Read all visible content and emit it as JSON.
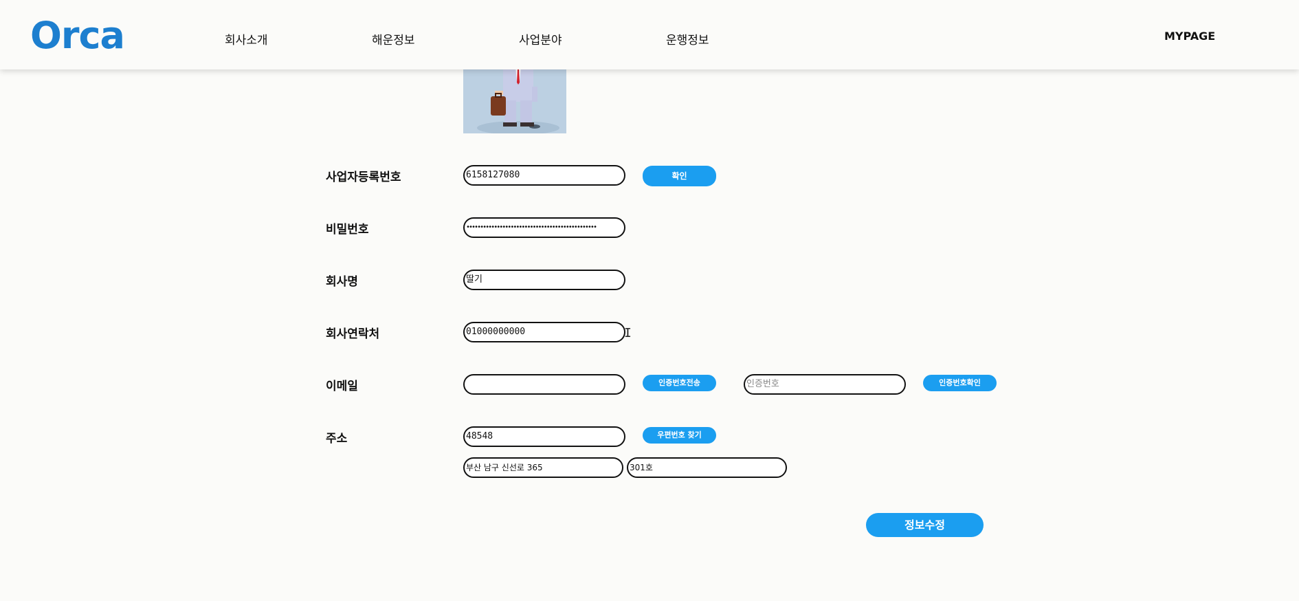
{
  "header": {
    "logo": "Orca",
    "nav": [
      "회사소개",
      "해운정보",
      "사업분야",
      "운행정보"
    ],
    "mypage": "MYPAGE"
  },
  "form": {
    "business_number": {
      "label": "사업자등록번호",
      "value": "6158127080",
      "button": "확인"
    },
    "password": {
      "label": "비밀번호",
      "value": "•••••••••••••••••••••••••••••••••••••••••••••••"
    },
    "company_name": {
      "label": "회사명",
      "value": "딸기"
    },
    "company_contact": {
      "label": "회사연락처",
      "value": "01000000000"
    },
    "email": {
      "label": "이메일",
      "value": "",
      "send_button": "인증번호전송",
      "code_placeholder": "인증번호",
      "confirm_button": "인증번호확인"
    },
    "address": {
      "label": "주소",
      "postcode": "48548",
      "find_button": "우편번호 찾기",
      "address1": "부산 남구 신선로 365",
      "address2": "301호"
    },
    "submit": "정보수정"
  },
  "colors": {
    "brand": "#1d7fcf",
    "button": "#1b9ef0",
    "background": "#fbfbf9"
  }
}
